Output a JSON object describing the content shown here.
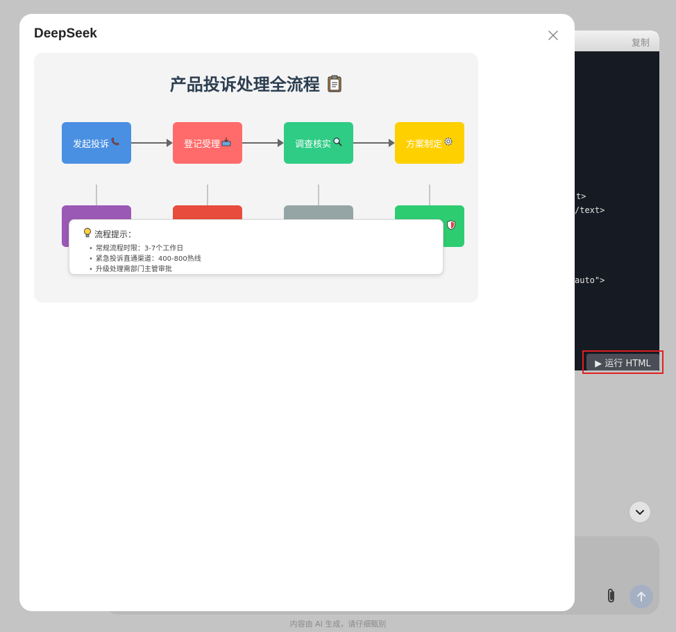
{
  "background": {
    "code_panel": {
      "copy_label": "复制",
      "lines": [
        {
          "text": "t>"
        },
        {
          "text": "/text>"
        },
        {
          "text": "auto\">"
        }
      ]
    },
    "run_button": {
      "icon": "play-icon",
      "label": "▶ 运行 HTML"
    },
    "scroll_down_icon": "chevron-down-icon",
    "attach_icon": "paperclip-icon",
    "send_icon": "arrow-up-icon",
    "disclaimer": "内容由 AI 生成，请仔细甄别"
  },
  "modal": {
    "title": "DeepSeek",
    "close_icon": "close-icon",
    "preview": {
      "title": "产品投诉处理全流程",
      "title_emoji": "clipboard-icon",
      "steps_row1": [
        {
          "label": "发起投诉",
          "icon": "phone-icon",
          "color": "#4a90e2"
        },
        {
          "label": "登记受理",
          "icon": "inbox-icon",
          "color": "#ff6b6b"
        },
        {
          "label": "调查核实",
          "icon": "magnifier-icon",
          "color": "#2ecc85"
        },
        {
          "label": "方案制定",
          "icon": "gear-icon",
          "color": "#ffd000"
        }
      ],
      "steps_row2": [
        {
          "color": "#9b59b6"
        },
        {
          "color": "#e74c3c"
        },
        {
          "color": "#95a5a6"
        },
        {
          "icon": "shield-icon",
          "color": "#2ecc71"
        }
      ],
      "tip": {
        "title": "流程提示：",
        "icon": "lightbulb-icon",
        "items": [
          "常规流程时限：3-7个工作日",
          "紧急投诉直通渠道：400-800热线",
          "升级处理需部门主管审批"
        ]
      }
    }
  }
}
